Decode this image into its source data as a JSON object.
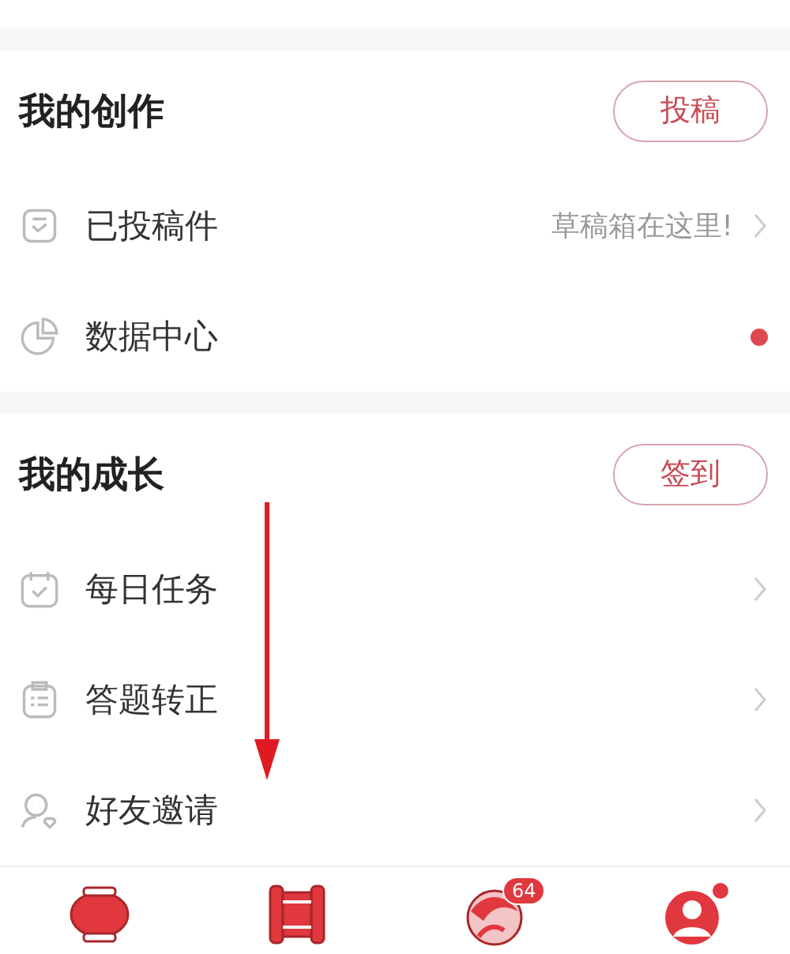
{
  "sections": [
    {
      "title": "我的创作",
      "action": "投稿",
      "items": [
        {
          "label": "已投稿件",
          "hint": "草稿箱在这里!",
          "kind": "chevron"
        },
        {
          "label": "数据中心",
          "kind": "dot"
        }
      ]
    },
    {
      "title": "我的成长",
      "action": "签到",
      "items": [
        {
          "label": "每日任务",
          "kind": "chevron"
        },
        {
          "label": "答题转正",
          "kind": "chevron"
        },
        {
          "label": "好友邀请",
          "kind": "chevron"
        }
      ]
    }
  ],
  "tabs": [
    {
      "kind": "lantern",
      "dot": false
    },
    {
      "kind": "scroll",
      "dot": false
    },
    {
      "kind": "ball",
      "badge": "64",
      "dot": false
    },
    {
      "kind": "avatar",
      "dot": true
    }
  ]
}
